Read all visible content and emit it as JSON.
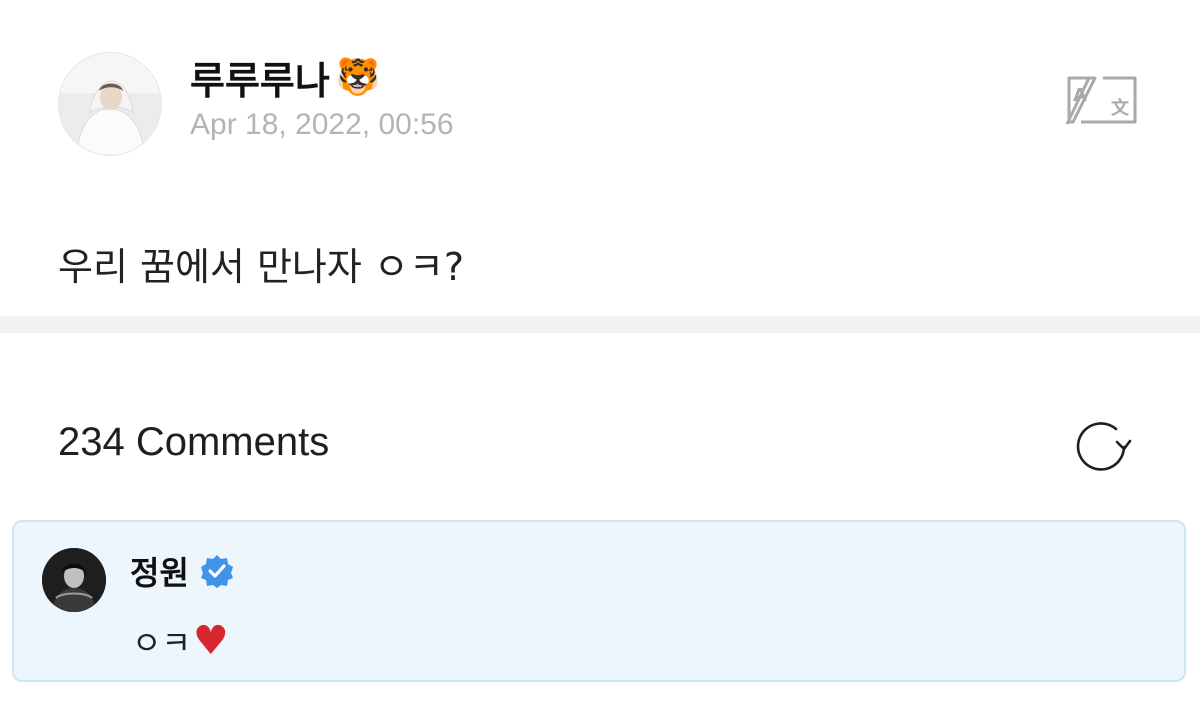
{
  "post": {
    "author_name": "루루루나",
    "author_emoji": "🐯",
    "date": "Apr 18, 2022, 00:56",
    "body": "우리 꿈에서 만나자 ㅇㅋ?",
    "translate_icon": "translate-icon"
  },
  "comments": {
    "count_label": "234 Comments",
    "refresh_icon": "refresh-icon",
    "items": [
      {
        "author": "정원",
        "verified": true,
        "text": "ㅇㅋ",
        "emoji": "♥"
      }
    ]
  },
  "colors": {
    "comment_bg": "#ecf6fc",
    "comment_border": "#cde6f3",
    "verified": "#3f93e8",
    "heart": "#d8262e",
    "date": "#b4b4b4",
    "divider": "#f2f2f5"
  }
}
